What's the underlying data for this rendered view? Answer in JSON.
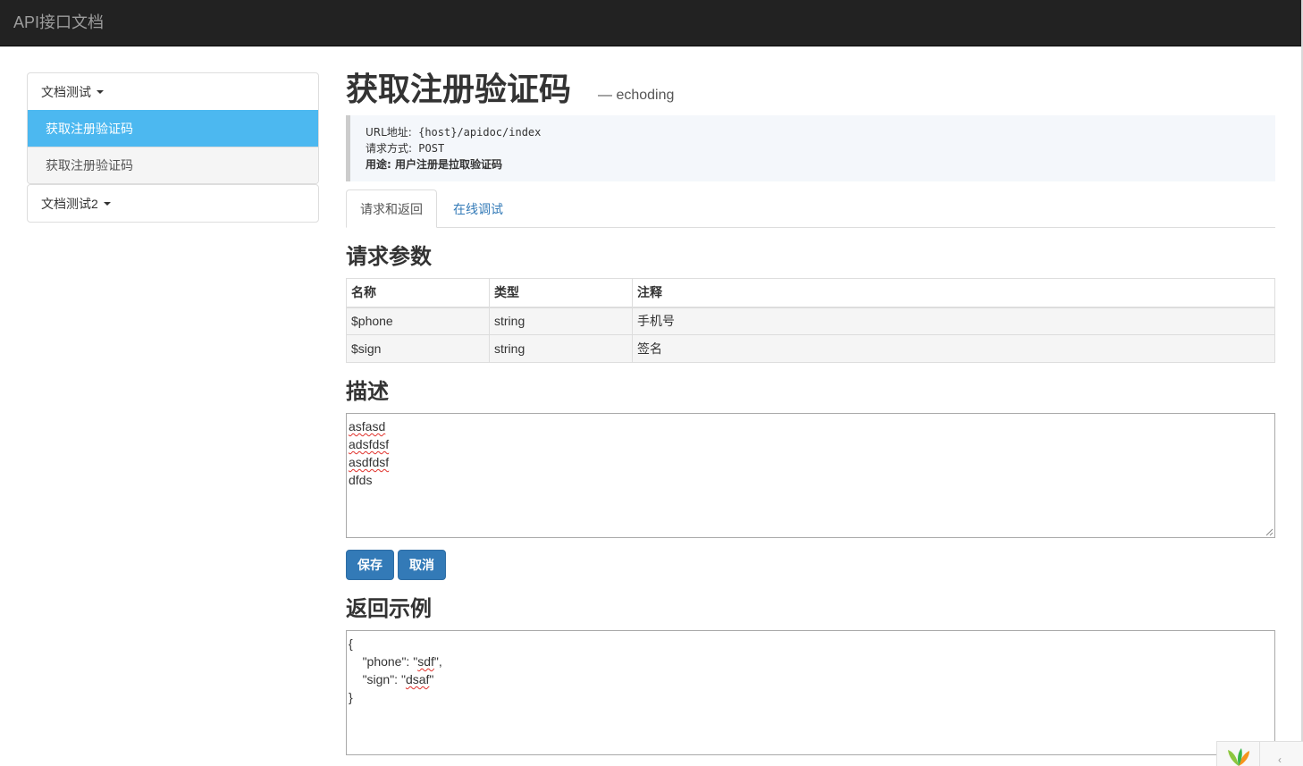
{
  "navbar": {
    "brand": "API接口文档"
  },
  "sidebar": {
    "groups": [
      {
        "title": "文档测试",
        "items": [
          {
            "label": "获取注册验证码",
            "active": true
          },
          {
            "label": "获取注册验证码",
            "active": false
          }
        ]
      },
      {
        "title": "文档测试2",
        "items": []
      }
    ]
  },
  "main": {
    "title": "获取注册验证码",
    "author": "— echoding",
    "info": {
      "url_label": "URL地址:",
      "url_value": "{host}/apidoc/index",
      "method_label": "请求方式:",
      "method_value": "POST",
      "purpose_label": "用途:",
      "purpose_value": "用户注册是拉取验证码"
    },
    "tabs": [
      {
        "label": "请求和返回",
        "active": true
      },
      {
        "label": "在线调试",
        "active": false
      }
    ],
    "params_heading": "请求参数",
    "params_table": {
      "headers": [
        "名称",
        "类型",
        "注释"
      ],
      "rows": [
        [
          "$phone",
          "string",
          "手机号"
        ],
        [
          "$sign",
          "string",
          "签名"
        ]
      ]
    },
    "description_heading": "描述",
    "description_lines": [
      "asfasd",
      "adsfdsf",
      "asdfdsf",
      "dfds"
    ],
    "buttons": {
      "save": "保存",
      "cancel": "取消"
    },
    "example_heading": "返回示例",
    "example_lines": {
      "open": "{",
      "l1_key": "\"phone\": \"",
      "l1_val": "sdf",
      "l1_end": "\",",
      "l2_key": "\"sign\": \"",
      "l2_val": "dsaf",
      "l2_end": "\"",
      "close": "}"
    }
  },
  "colors": {
    "navbar": "#222222",
    "active_item": "#4cb8f0",
    "button": "#337ab7",
    "link": "#337ab7"
  },
  "icons": {
    "dropdown": "caret-down-icon",
    "corner": "leaf-logo-icon",
    "collapse": "chevron-left-icon"
  }
}
